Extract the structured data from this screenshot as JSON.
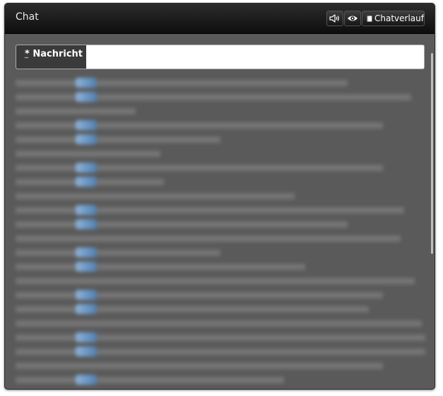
{
  "header": {
    "title": "Chat",
    "sound_icon": "speaker-icon",
    "eye_icon": "eye-icon",
    "history_icon": "book-icon",
    "history_label": "Chatverlauf"
  },
  "input": {
    "required_mark": "*",
    "label": "Nachricht",
    "value": ""
  },
  "messages": [],
  "colors": {
    "panel_bg": "#5a5a5a",
    "header_bg": "#111111",
    "label_bg": "#3a3a3a"
  }
}
